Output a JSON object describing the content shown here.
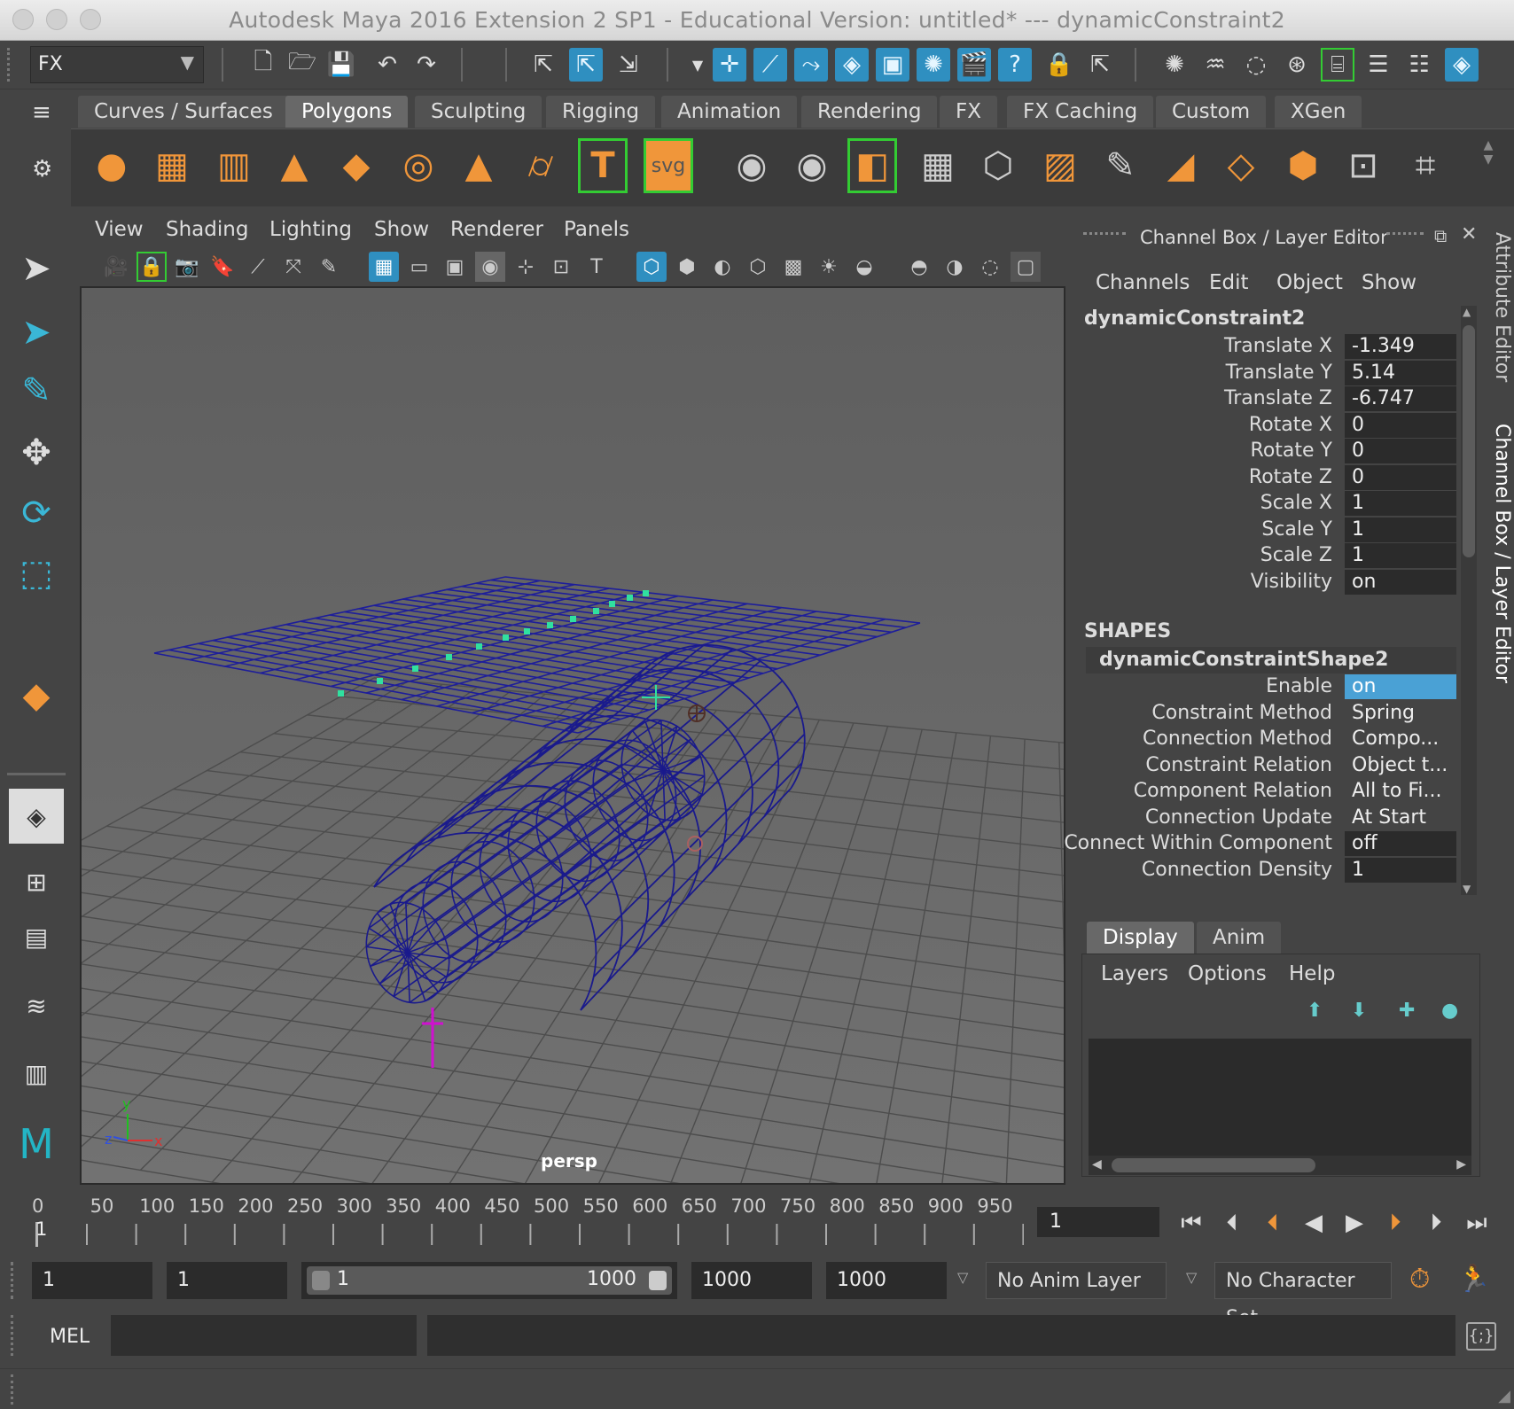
{
  "window": {
    "title": "Autodesk Maya 2016 Extension 2 SP1 - Educational Version: untitled*   ---   dynamicConstraint2"
  },
  "statusline": {
    "menuset": "FX"
  },
  "shelf": {
    "tabs": [
      "Curves / Surfaces",
      "Polygons",
      "Sculpting",
      "Rigging",
      "Animation",
      "Rendering",
      "FX",
      "FX Caching",
      "Custom",
      "XGen"
    ],
    "active": "Polygons"
  },
  "viewport": {
    "menus": [
      "View",
      "Shading",
      "Lighting",
      "Show",
      "Renderer",
      "Panels"
    ],
    "camera_label": "persp",
    "axis": {
      "y": "y",
      "x": "x",
      "z": "z"
    }
  },
  "channel_box": {
    "header": "Channel Box / Layer Editor",
    "menus": [
      "Channels",
      "Edit",
      "Object",
      "Show"
    ],
    "node": "dynamicConstraint2",
    "attributes": [
      {
        "label": "Translate X",
        "value": "-1.349"
      },
      {
        "label": "Translate Y",
        "value": "5.14"
      },
      {
        "label": "Translate Z",
        "value": "-6.747"
      },
      {
        "label": "Rotate X",
        "value": "0"
      },
      {
        "label": "Rotate Y",
        "value": "0"
      },
      {
        "label": "Rotate Z",
        "value": "0"
      },
      {
        "label": "Scale X",
        "value": "1"
      },
      {
        "label": "Scale Y",
        "value": "1"
      },
      {
        "label": "Scale Z",
        "value": "1"
      },
      {
        "label": "Visibility",
        "value": "on"
      }
    ],
    "shapes_label": "SHAPES",
    "shape_node": "dynamicConstraintShape2",
    "shape_attributes": [
      {
        "label": "Enable",
        "value": "on"
      },
      {
        "label": "Constraint Method",
        "value": "Spring"
      },
      {
        "label": "Connection Method",
        "value": "Compo..."
      },
      {
        "label": "Constraint Relation",
        "value": "Object t..."
      },
      {
        "label": "Component Relation",
        "value": "All to Fi..."
      },
      {
        "label": "Connection Update",
        "value": "At Start"
      },
      {
        "label": "Connect Within Component",
        "value": "off"
      },
      {
        "label": "Connection Density",
        "value": "1"
      }
    ],
    "side_tabs": [
      "Attribute Editor",
      "Channel Box / Layer Editor"
    ]
  },
  "layer_editor": {
    "tabs": [
      "Display",
      "Anim"
    ],
    "active_tab": "Display",
    "menus": [
      "Layers",
      "Options",
      "Help"
    ]
  },
  "time_slider": {
    "ticks": [
      "0",
      "50",
      "100",
      "150",
      "200",
      "250",
      "300",
      "350",
      "400",
      "450",
      "500",
      "550",
      "600",
      "650",
      "700",
      "750",
      "800",
      "850",
      "900",
      "950"
    ],
    "current_marker": "1",
    "current_frame": "1"
  },
  "range_slider": {
    "start": "1",
    "inner_start": "1",
    "range_min": "1",
    "range_max": "1000",
    "inner_end": "1000",
    "end": "1000",
    "anim_layer": "No Anim Layer",
    "character_set": "No Character Set"
  },
  "command_line": {
    "language": "MEL"
  },
  "colors": {
    "accent": "#2f8fc0",
    "highlight": "#4aa1d5",
    "shelf_icon": "#f0963a",
    "wireframe": "#1a1a8c",
    "selection": "#30e0a0"
  }
}
